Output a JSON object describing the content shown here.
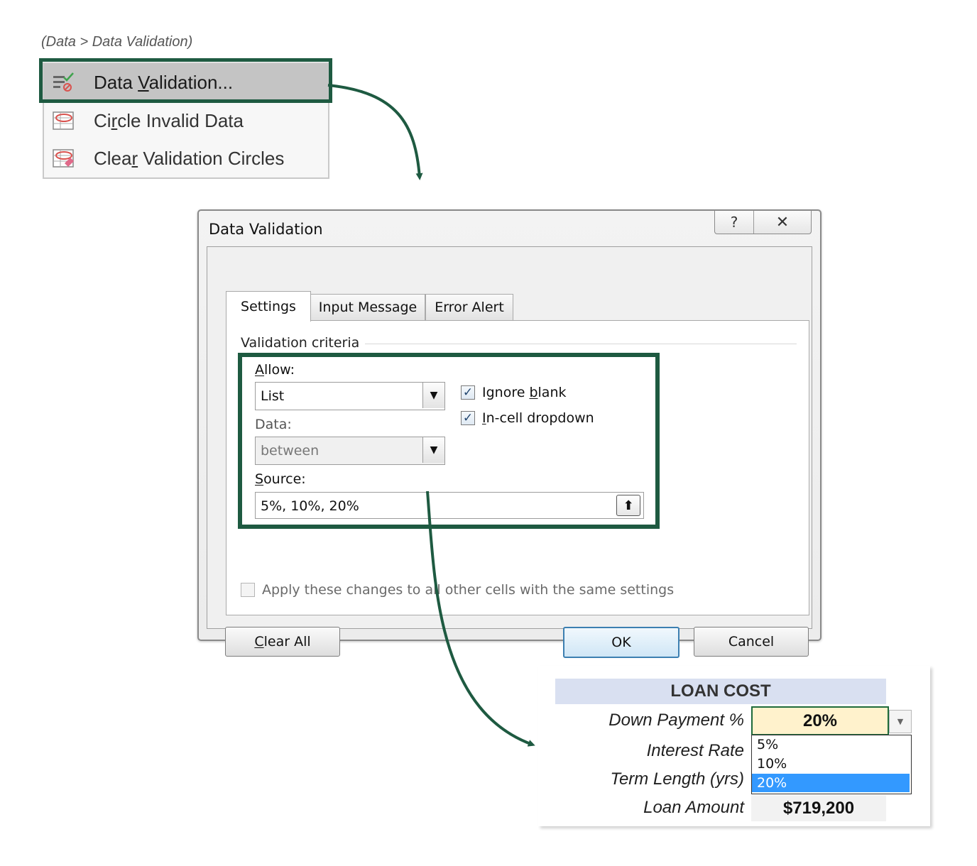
{
  "breadcrumb": "(Data > Data Validation)",
  "menu": {
    "items": [
      {
        "pre": "Data ",
        "key": "V",
        "post": "alidation...",
        "icon": "data-validation-icon"
      },
      {
        "pre": "Ci",
        "key": "r",
        "post": "cle Invalid Data",
        "icon": "circle-invalid-data-icon"
      },
      {
        "pre": "Clea",
        "key": "r",
        "post": " Validation Circles",
        "icon": "clear-validation-circles-icon"
      }
    ]
  },
  "dialog": {
    "title": "Data Validation",
    "help_glyph": "?",
    "close_glyph": "✕",
    "tabs": [
      "Settings",
      "Input Message",
      "Error Alert"
    ],
    "criteria_label": "Validation criteria",
    "allow": {
      "key": "A",
      "rest": "llow:",
      "value": "List"
    },
    "data": {
      "label": "Data:",
      "value": "between"
    },
    "source": {
      "key": "S",
      "rest": "ource:",
      "value": "5%, 10%, 20%",
      "button_glyph": "⬆"
    },
    "ignore_blank": {
      "pre": "Ignore ",
      "key": "b",
      "post": "lank",
      "checked": true
    },
    "incell_dropdown": {
      "key": "I",
      "post": "n-cell dropdown",
      "checked": true
    },
    "apply_all": {
      "label": "Apply these changes to all other cells with the same settings",
      "checked": false
    },
    "buttons": {
      "clear_all": {
        "key": "C",
        "rest": "lear All"
      },
      "ok": "OK",
      "cancel": "Cancel"
    },
    "checkmark": "✓",
    "combo_arrow": "▼"
  },
  "sheet": {
    "title": "LOAN COST",
    "rows": {
      "down_payment": {
        "label": "Down Payment %",
        "value": "20%"
      },
      "interest_rate": {
        "label": "Interest Rate"
      },
      "term_length": {
        "label": "Term Length (yrs)"
      },
      "loan_amount": {
        "label": "Loan Amount",
        "value": "$719,200"
      }
    },
    "dropdown_arrow": "▼",
    "dropdown_options": [
      "5%",
      "10%",
      "20%"
    ],
    "selected_option": "20%"
  },
  "colors": {
    "highlight_border": "#1e5a41",
    "arrow": "#1e5a41",
    "loan_header_bg": "#d9e0f1",
    "input_cell_bg": "#fff2cc",
    "dropdown_selected_bg": "#3399ff"
  }
}
